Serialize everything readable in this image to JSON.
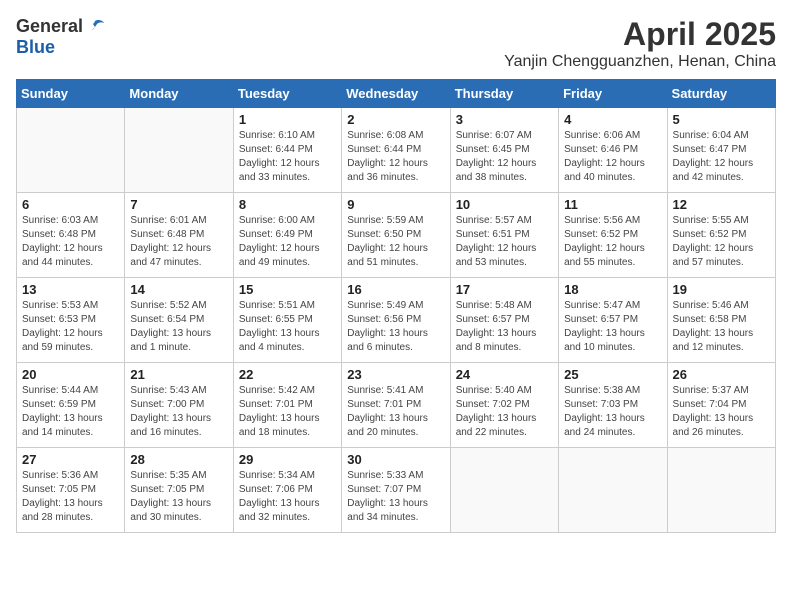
{
  "header": {
    "logo_general": "General",
    "logo_blue": "Blue",
    "month_title": "April 2025",
    "subtitle": "Yanjin Chengguanzhen, Henan, China"
  },
  "days_of_week": [
    "Sunday",
    "Monday",
    "Tuesday",
    "Wednesday",
    "Thursday",
    "Friday",
    "Saturday"
  ],
  "weeks": [
    [
      {
        "day": "",
        "sunrise": "",
        "sunset": "",
        "daylight": ""
      },
      {
        "day": "",
        "sunrise": "",
        "sunset": "",
        "daylight": ""
      },
      {
        "day": "1",
        "sunrise": "Sunrise: 6:10 AM",
        "sunset": "Sunset: 6:44 PM",
        "daylight": "Daylight: 12 hours and 33 minutes."
      },
      {
        "day": "2",
        "sunrise": "Sunrise: 6:08 AM",
        "sunset": "Sunset: 6:44 PM",
        "daylight": "Daylight: 12 hours and 36 minutes."
      },
      {
        "day": "3",
        "sunrise": "Sunrise: 6:07 AM",
        "sunset": "Sunset: 6:45 PM",
        "daylight": "Daylight: 12 hours and 38 minutes."
      },
      {
        "day": "4",
        "sunrise": "Sunrise: 6:06 AM",
        "sunset": "Sunset: 6:46 PM",
        "daylight": "Daylight: 12 hours and 40 minutes."
      },
      {
        "day": "5",
        "sunrise": "Sunrise: 6:04 AM",
        "sunset": "Sunset: 6:47 PM",
        "daylight": "Daylight: 12 hours and 42 minutes."
      }
    ],
    [
      {
        "day": "6",
        "sunrise": "Sunrise: 6:03 AM",
        "sunset": "Sunset: 6:48 PM",
        "daylight": "Daylight: 12 hours and 44 minutes."
      },
      {
        "day": "7",
        "sunrise": "Sunrise: 6:01 AM",
        "sunset": "Sunset: 6:48 PM",
        "daylight": "Daylight: 12 hours and 47 minutes."
      },
      {
        "day": "8",
        "sunrise": "Sunrise: 6:00 AM",
        "sunset": "Sunset: 6:49 PM",
        "daylight": "Daylight: 12 hours and 49 minutes."
      },
      {
        "day": "9",
        "sunrise": "Sunrise: 5:59 AM",
        "sunset": "Sunset: 6:50 PM",
        "daylight": "Daylight: 12 hours and 51 minutes."
      },
      {
        "day": "10",
        "sunrise": "Sunrise: 5:57 AM",
        "sunset": "Sunset: 6:51 PM",
        "daylight": "Daylight: 12 hours and 53 minutes."
      },
      {
        "day": "11",
        "sunrise": "Sunrise: 5:56 AM",
        "sunset": "Sunset: 6:52 PM",
        "daylight": "Daylight: 12 hours and 55 minutes."
      },
      {
        "day": "12",
        "sunrise": "Sunrise: 5:55 AM",
        "sunset": "Sunset: 6:52 PM",
        "daylight": "Daylight: 12 hours and 57 minutes."
      }
    ],
    [
      {
        "day": "13",
        "sunrise": "Sunrise: 5:53 AM",
        "sunset": "Sunset: 6:53 PM",
        "daylight": "Daylight: 12 hours and 59 minutes."
      },
      {
        "day": "14",
        "sunrise": "Sunrise: 5:52 AM",
        "sunset": "Sunset: 6:54 PM",
        "daylight": "Daylight: 13 hours and 1 minute."
      },
      {
        "day": "15",
        "sunrise": "Sunrise: 5:51 AM",
        "sunset": "Sunset: 6:55 PM",
        "daylight": "Daylight: 13 hours and 4 minutes."
      },
      {
        "day": "16",
        "sunrise": "Sunrise: 5:49 AM",
        "sunset": "Sunset: 6:56 PM",
        "daylight": "Daylight: 13 hours and 6 minutes."
      },
      {
        "day": "17",
        "sunrise": "Sunrise: 5:48 AM",
        "sunset": "Sunset: 6:57 PM",
        "daylight": "Daylight: 13 hours and 8 minutes."
      },
      {
        "day": "18",
        "sunrise": "Sunrise: 5:47 AM",
        "sunset": "Sunset: 6:57 PM",
        "daylight": "Daylight: 13 hours and 10 minutes."
      },
      {
        "day": "19",
        "sunrise": "Sunrise: 5:46 AM",
        "sunset": "Sunset: 6:58 PM",
        "daylight": "Daylight: 13 hours and 12 minutes."
      }
    ],
    [
      {
        "day": "20",
        "sunrise": "Sunrise: 5:44 AM",
        "sunset": "Sunset: 6:59 PM",
        "daylight": "Daylight: 13 hours and 14 minutes."
      },
      {
        "day": "21",
        "sunrise": "Sunrise: 5:43 AM",
        "sunset": "Sunset: 7:00 PM",
        "daylight": "Daylight: 13 hours and 16 minutes."
      },
      {
        "day": "22",
        "sunrise": "Sunrise: 5:42 AM",
        "sunset": "Sunset: 7:01 PM",
        "daylight": "Daylight: 13 hours and 18 minutes."
      },
      {
        "day": "23",
        "sunrise": "Sunrise: 5:41 AM",
        "sunset": "Sunset: 7:01 PM",
        "daylight": "Daylight: 13 hours and 20 minutes."
      },
      {
        "day": "24",
        "sunrise": "Sunrise: 5:40 AM",
        "sunset": "Sunset: 7:02 PM",
        "daylight": "Daylight: 13 hours and 22 minutes."
      },
      {
        "day": "25",
        "sunrise": "Sunrise: 5:38 AM",
        "sunset": "Sunset: 7:03 PM",
        "daylight": "Daylight: 13 hours and 24 minutes."
      },
      {
        "day": "26",
        "sunrise": "Sunrise: 5:37 AM",
        "sunset": "Sunset: 7:04 PM",
        "daylight": "Daylight: 13 hours and 26 minutes."
      }
    ],
    [
      {
        "day": "27",
        "sunrise": "Sunrise: 5:36 AM",
        "sunset": "Sunset: 7:05 PM",
        "daylight": "Daylight: 13 hours and 28 minutes."
      },
      {
        "day": "28",
        "sunrise": "Sunrise: 5:35 AM",
        "sunset": "Sunset: 7:05 PM",
        "daylight": "Daylight: 13 hours and 30 minutes."
      },
      {
        "day": "29",
        "sunrise": "Sunrise: 5:34 AM",
        "sunset": "Sunset: 7:06 PM",
        "daylight": "Daylight: 13 hours and 32 minutes."
      },
      {
        "day": "30",
        "sunrise": "Sunrise: 5:33 AM",
        "sunset": "Sunset: 7:07 PM",
        "daylight": "Daylight: 13 hours and 34 minutes."
      },
      {
        "day": "",
        "sunrise": "",
        "sunset": "",
        "daylight": ""
      },
      {
        "day": "",
        "sunrise": "",
        "sunset": "",
        "daylight": ""
      },
      {
        "day": "",
        "sunrise": "",
        "sunset": "",
        "daylight": ""
      }
    ]
  ]
}
